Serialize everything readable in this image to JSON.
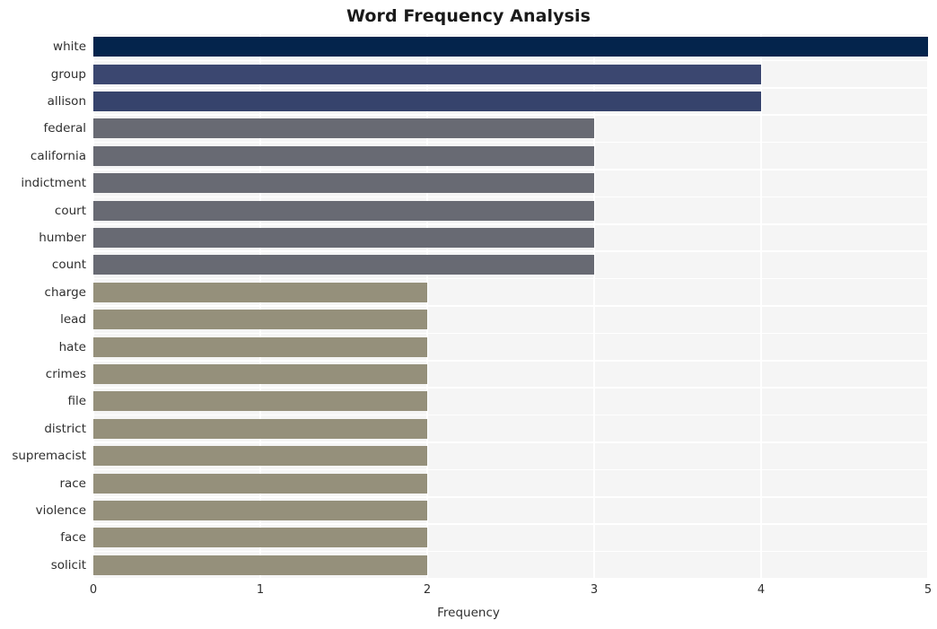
{
  "chart_data": {
    "type": "bar",
    "orientation": "horizontal",
    "title": "Word Frequency Analysis",
    "xlabel": "Frequency",
    "ylabel": "",
    "xlim": [
      0,
      5
    ],
    "xticks": [
      "0",
      "1",
      "2",
      "3",
      "4",
      "5"
    ],
    "grid": true,
    "legend": "none",
    "categories": [
      "white",
      "group",
      "allison",
      "federal",
      "california",
      "indictment",
      "court",
      "humber",
      "count",
      "charge",
      "lead",
      "hate",
      "crimes",
      "file",
      "district",
      "supremacist",
      "race",
      "violence",
      "face",
      "solicit"
    ],
    "values": [
      5,
      4,
      4,
      3,
      3,
      3,
      3,
      3,
      3,
      2,
      2,
      2,
      2,
      2,
      2,
      2,
      2,
      2,
      2,
      2
    ],
    "bar_colors": [
      "#04244c",
      "#3b4770",
      "#36436c",
      "#686a73",
      "#686a73",
      "#686a73",
      "#686a73",
      "#686a73",
      "#686a73",
      "#95907b",
      "#95907b",
      "#95907b",
      "#95907b",
      "#95907b",
      "#95907b",
      "#95907b",
      "#95907b",
      "#95907b",
      "#95907b",
      "#95907b"
    ]
  },
  "style": {
    "plot_background": "#f5f5f5",
    "gridline_color": "#ffffff",
    "figure_background": "#ffffff",
    "text_color": "#2f2f2f",
    "title_color": "#1a1a1a"
  }
}
